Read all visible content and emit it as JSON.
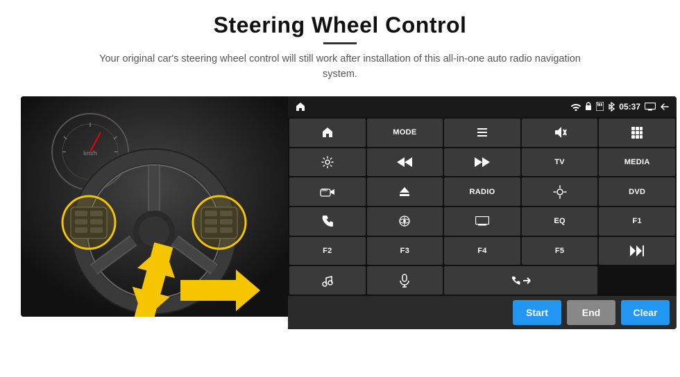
{
  "page": {
    "title": "Steering Wheel Control",
    "subtitle": "Your original car's steering wheel control will still work after installation of this all-in-one auto radio navigation system.",
    "divider": true
  },
  "status_bar": {
    "time": "05:37",
    "icons": [
      "wifi",
      "lock",
      "memory",
      "bluetooth",
      "display",
      "back"
    ]
  },
  "button_grid": [
    {
      "label": "",
      "icon": "home",
      "row": 1,
      "col": 1
    },
    {
      "label": "MODE",
      "icon": "",
      "row": 1,
      "col": 2
    },
    {
      "label": "",
      "icon": "list",
      "row": 1,
      "col": 3
    },
    {
      "label": "",
      "icon": "mute",
      "row": 1,
      "col": 4
    },
    {
      "label": "",
      "icon": "apps",
      "row": 1,
      "col": 5
    },
    {
      "label": "",
      "icon": "settings",
      "row": 2,
      "col": 1
    },
    {
      "label": "",
      "icon": "prev",
      "row": 2,
      "col": 2
    },
    {
      "label": "",
      "icon": "next",
      "row": 2,
      "col": 3
    },
    {
      "label": "TV",
      "icon": "",
      "row": 2,
      "col": 4
    },
    {
      "label": "MEDIA",
      "icon": "",
      "row": 2,
      "col": 5
    },
    {
      "label": "",
      "icon": "360cam",
      "row": 3,
      "col": 1
    },
    {
      "label": "",
      "icon": "eject",
      "row": 3,
      "col": 2
    },
    {
      "label": "RADIO",
      "icon": "",
      "row": 3,
      "col": 3
    },
    {
      "label": "",
      "icon": "brightness",
      "row": 3,
      "col": 4
    },
    {
      "label": "DVD",
      "icon": "",
      "row": 3,
      "col": 5
    },
    {
      "label": "",
      "icon": "phone",
      "row": 4,
      "col": 1
    },
    {
      "label": "",
      "icon": "navi",
      "row": 4,
      "col": 2
    },
    {
      "label": "",
      "icon": "screen",
      "row": 4,
      "col": 3
    },
    {
      "label": "EQ",
      "icon": "",
      "row": 4,
      "col": 4
    },
    {
      "label": "F1",
      "icon": "",
      "row": 4,
      "col": 5
    },
    {
      "label": "F2",
      "icon": "",
      "row": 5,
      "col": 1
    },
    {
      "label": "F3",
      "icon": "",
      "row": 5,
      "col": 2
    },
    {
      "label": "F4",
      "icon": "",
      "row": 5,
      "col": 3
    },
    {
      "label": "F5",
      "icon": "",
      "row": 5,
      "col": 4
    },
    {
      "label": "",
      "icon": "playpause",
      "row": 5,
      "col": 5
    },
    {
      "label": "",
      "icon": "music",
      "row": 6,
      "col": 1
    },
    {
      "label": "",
      "icon": "mic",
      "row": 6,
      "col": 2
    },
    {
      "label": "",
      "icon": "volphone",
      "row": 6,
      "col": 3
    },
    {
      "label": "",
      "icon": "",
      "row": 6,
      "col": 4
    },
    {
      "label": "",
      "icon": "",
      "row": 6,
      "col": 5
    }
  ],
  "action_buttons": {
    "start": "Start",
    "end": "End",
    "clear": "Clear"
  }
}
